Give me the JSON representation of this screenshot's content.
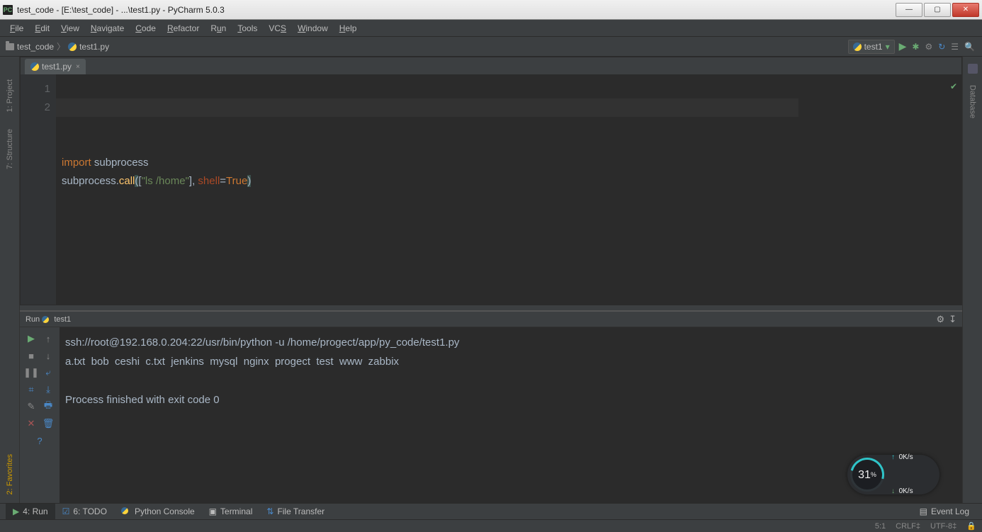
{
  "title": "test_code - [E:\\test_code] - ...\\test1.py - PyCharm 5.0.3",
  "menu": [
    "File",
    "Edit",
    "View",
    "Navigate",
    "Code",
    "Refactor",
    "Run",
    "Tools",
    "VCS",
    "Window",
    "Help"
  ],
  "breadcrumb": {
    "root": "test_code",
    "file": "test1.py"
  },
  "run_config": "test1",
  "tab": {
    "name": "test1.py"
  },
  "code": {
    "lines": [
      "1",
      "2"
    ],
    "l1_kw": "import",
    "l1_mod": " subprocess",
    "l2_a": "subprocess.",
    "l2_fn": "call",
    "l2_p1": "(",
    "l2_b1": "[",
    "l2_str": "\"ls /home\"",
    "l2_b2": "], ",
    "l2_arg": "shell",
    "l2_eq": "=",
    "l2_true": "True",
    "l2_p2": ")"
  },
  "left_tabs": [
    "1: Project",
    "7: Structure"
  ],
  "left_bottom": "2: Favorites",
  "right_tab": "Database",
  "run": {
    "title": "Run",
    "name": "test1",
    "line1": "ssh://root@192.168.0.204:22/usr/bin/python -u /home/progect/app/py_code/test1.py",
    "line2": "a.txt  bob  ceshi  c.txt  jenkins  mysql  nginx  progect  test  www  zabbix",
    "line3": "",
    "line4": "Process finished with exit code 0"
  },
  "speed": {
    "pct": "31",
    "pct_unit": "%",
    "up": "0K/s",
    "down": "0K/s"
  },
  "bottom_tools": {
    "run": "4: Run",
    "todo": "6: TODO",
    "pyconsole": "Python Console",
    "terminal": "Terminal",
    "filetransfer": "File Transfer",
    "eventlog": "Event Log"
  },
  "status": {
    "pos": "5:1",
    "crlf": "CRLF‡",
    "enc": "UTF-8‡"
  }
}
